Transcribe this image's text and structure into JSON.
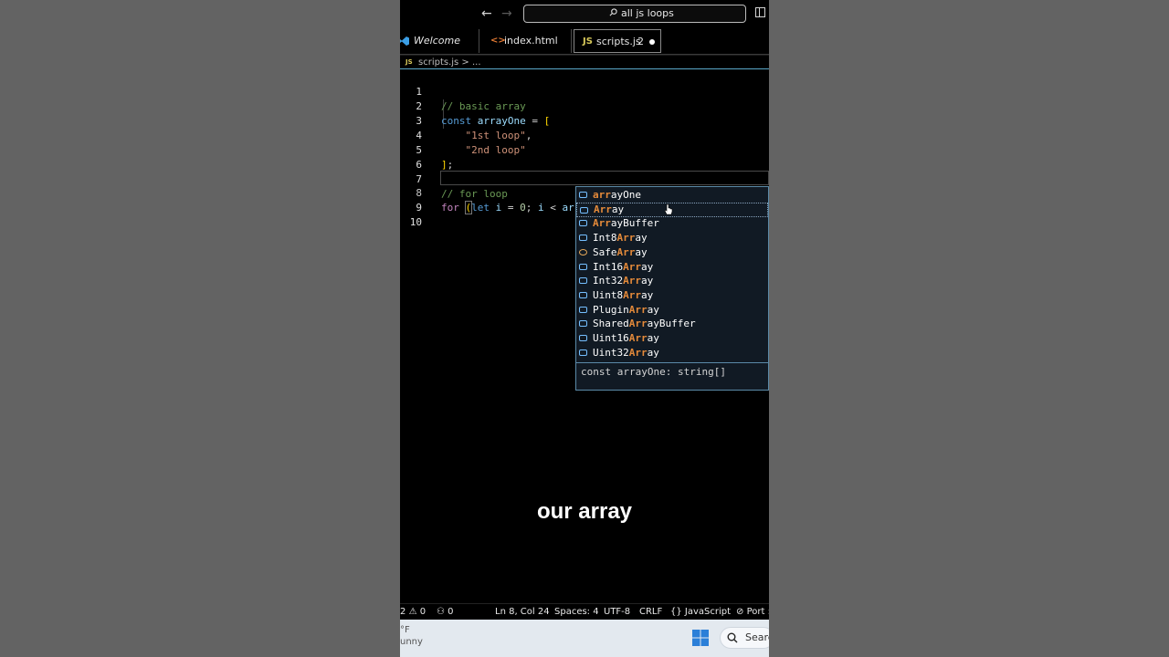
{
  "titlebar": {
    "back_glyph": "←",
    "forward_glyph": "→",
    "search_text": "all js loops"
  },
  "tabs": [
    {
      "label": "Welcome",
      "icon": "vscode-logo-icon"
    },
    {
      "label": "index.html",
      "icon": "html-icon",
      "icon_glyph": "<>"
    },
    {
      "label": "scripts.js",
      "icon": "js-icon",
      "icon_glyph": "JS",
      "badge": "2",
      "modified": true
    }
  ],
  "breadcrumb": {
    "icon_glyph": "JS",
    "text": "scripts.js > ..."
  },
  "editor": {
    "line_numbers": [
      "1",
      "2",
      "3",
      "4",
      "5",
      "6",
      "7",
      "8",
      "9",
      "10"
    ],
    "lines": {
      "l1": "// basic array",
      "l2_kw": "const",
      "l2_var": "arrayOne",
      "l2_op": "=",
      "l2_br": "[",
      "l3_str": "\"1st loop\"",
      "l3_p": ",",
      "l4_str": "\"2nd loop\"",
      "l5_br": "]",
      "l5_p": ";",
      "l7": "// for loop",
      "l8_for": "for",
      "l8_br": "(",
      "l8_let": "let",
      "l8_i": "i",
      "l8_eq": "=",
      "l8_zero": "0",
      "l8_semi": ";",
      "l8_i2": "i",
      "l8_lt": "<",
      "l8_arr": "arr",
      "l8_close": ")"
    }
  },
  "autocomplete": {
    "items": [
      {
        "match": "arr",
        "rest": "ayOne",
        "pre": ""
      },
      {
        "match": "Arr",
        "rest": "ay",
        "pre": ""
      },
      {
        "match": "Arr",
        "rest": "ayBuffer",
        "pre": ""
      },
      {
        "pre": "Int8",
        "match": "Arr",
        "rest": "ay"
      },
      {
        "pre": "Safe",
        "match": "Arr",
        "rest": "ay"
      },
      {
        "pre": "Int16",
        "match": "Arr",
        "rest": "ay"
      },
      {
        "pre": "Int32",
        "match": "Arr",
        "rest": "ay"
      },
      {
        "pre": "Uint8",
        "match": "Arr",
        "rest": "ay"
      },
      {
        "pre": "Plugin",
        "match": "Arr",
        "rest": "ay"
      },
      {
        "pre": "Shared",
        "match": "Arr",
        "rest": "ayBuffer"
      },
      {
        "pre": "Uint16",
        "match": "Arr",
        "rest": "ay"
      },
      {
        "pre": "Uint32",
        "match": "Arr",
        "rest": "ay"
      }
    ],
    "detail": "const arrayOne: string[]"
  },
  "caption": "our array",
  "statusbar": {
    "problems_errors": "2",
    "problems_warnings": "0",
    "ports": "0",
    "position": "Ln 8, Col 24",
    "spaces": "Spaces: 4",
    "encoding": "UTF-8",
    "eol": "CRLF",
    "language": "JavaScript",
    "port_label": "Port :"
  },
  "taskbar": {
    "weather_temp": "°F",
    "weather_text": "unny",
    "search_text": "Searc"
  },
  "colors": {
    "keyword": "#569cd6",
    "variable": "#9cdcfe",
    "string": "#ce9178",
    "comment": "#6a9955",
    "match_highlight": "#e48a3a",
    "suggest_border": "#5b8aa8"
  }
}
